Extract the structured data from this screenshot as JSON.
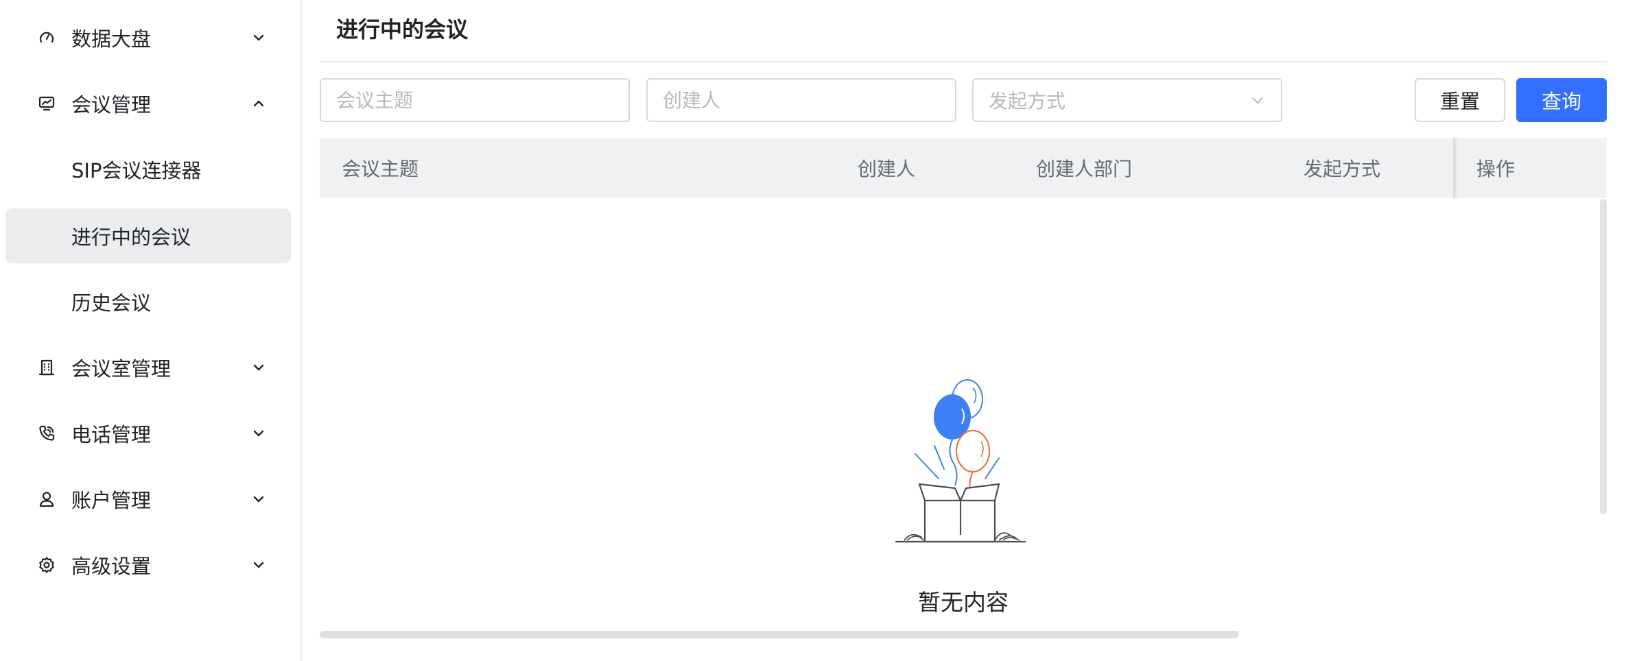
{
  "sidebar": {
    "items": [
      {
        "label": "数据大盘",
        "icon": "gauge-icon",
        "expanded": false
      },
      {
        "label": "会议管理",
        "icon": "monitor-chart-icon",
        "expanded": true,
        "children": [
          {
            "label": "SIP会议连接器"
          },
          {
            "label": "进行中的会议",
            "active": true
          },
          {
            "label": "历史会议"
          }
        ]
      },
      {
        "label": "会议室管理",
        "icon": "building-icon",
        "expanded": false
      },
      {
        "label": "电话管理",
        "icon": "phone-icon",
        "expanded": false
      },
      {
        "label": "账户管理",
        "icon": "user-icon",
        "expanded": false
      },
      {
        "label": "高级设置",
        "icon": "gear-icon",
        "expanded": false
      }
    ]
  },
  "page": {
    "title": "进行中的会议"
  },
  "filters": {
    "topic_placeholder": "会议主题",
    "creator_placeholder": "创建人",
    "method_placeholder": "发起方式",
    "reset_label": "重置",
    "query_label": "查询"
  },
  "table": {
    "columns": [
      "会议主题",
      "创建人",
      "创建人部门",
      "发起方式",
      "操作"
    ],
    "rows": [],
    "empty_text": "暂无内容"
  },
  "colors": {
    "accent": "#3370ff",
    "active_bg": "#ebecee",
    "balloon_blue": "#3d7ff5",
    "balloon_orange": "#f26e3f"
  }
}
